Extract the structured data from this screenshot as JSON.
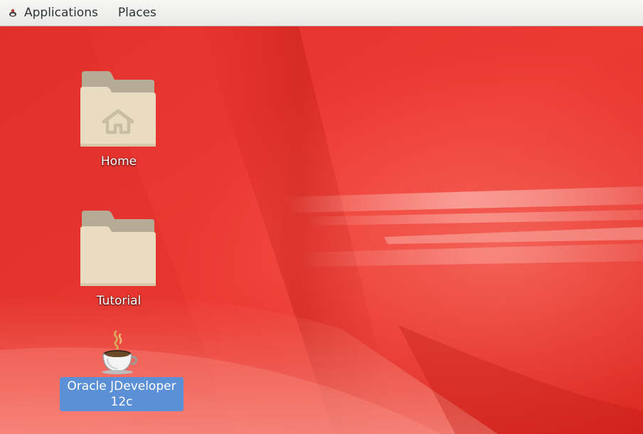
{
  "panel": {
    "applications_label": "Applications",
    "places_label": "Places"
  },
  "desktop": {
    "icons": [
      {
        "label": "Home",
        "icon": "home-folder-icon"
      },
      {
        "label": "Tutorial",
        "icon": "folder-icon"
      },
      {
        "label": "Oracle JDeveloper 12c",
        "icon": "java-coffee-cup-icon",
        "selected": true
      }
    ]
  },
  "colors": {
    "wallpaper_red": "#e8322e",
    "panel_bg": "#ececea",
    "folder_tan": "#e9dcc1",
    "selection_blue": "#5b8fd6"
  }
}
